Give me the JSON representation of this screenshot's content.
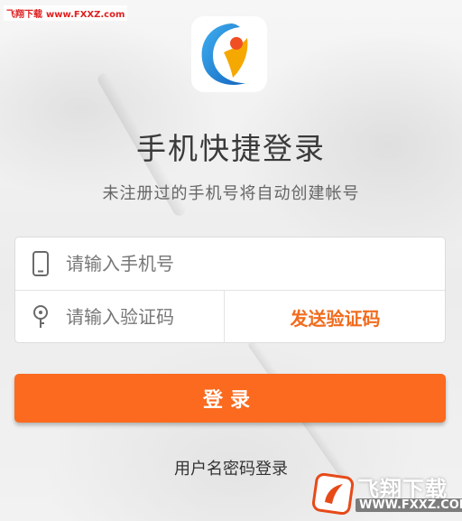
{
  "watermark_top": {
    "name": "飞翔下载",
    "url": "www.FXXZ.com"
  },
  "header": {
    "title": "手机快捷登录",
    "subtitle": "未注册过的手机号将自动创建帐号"
  },
  "form": {
    "phone": {
      "placeholder": "请输入手机号",
      "value": "",
      "icon": "phone-icon"
    },
    "code": {
      "placeholder": "请输入验证码",
      "value": "",
      "icon": "key-icon"
    },
    "send_code_label": "发送验证码"
  },
  "login_button_label": "登录",
  "password_login_label": "用户名密码登录",
  "watermark_bottom": {
    "name": "飞翔下载",
    "url": "WWW.FXXZ.COM"
  },
  "colors": {
    "accent": "#fb6a1e",
    "accent_text": "#f26b1d",
    "logo_blue": "#1e8fe0",
    "logo_yellow": "#f5a800",
    "logo_orange": "#f04e23"
  }
}
